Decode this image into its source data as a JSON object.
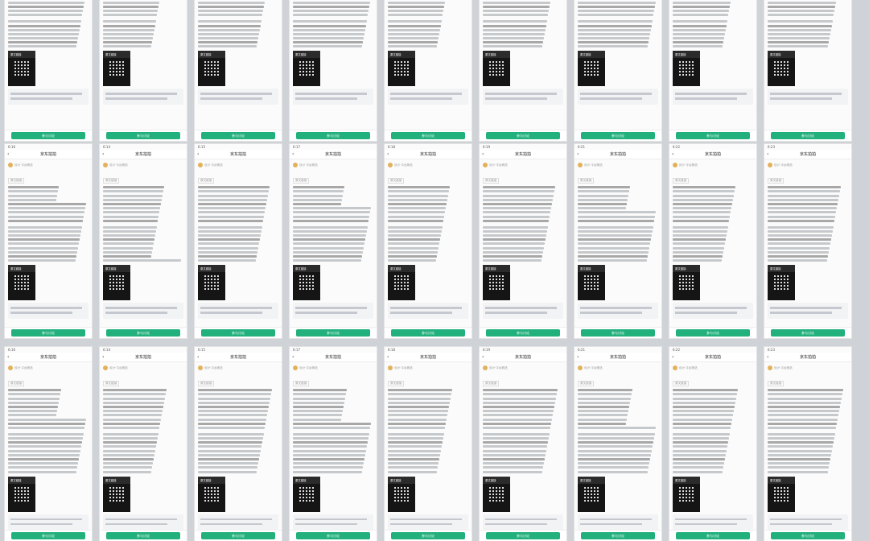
{
  "screen": {
    "title_bar_label": "京东拍拍",
    "status_times": [
      "6:16",
      "6:14",
      "6:15",
      "6:17",
      "6:18",
      "6:19",
      "6:21",
      "6:22",
      "6:23"
    ],
    "author_label": "设计·平台精选",
    "tag_label": "原文链接",
    "image_card_label": "原文链接",
    "cta_label": "参与讨论"
  },
  "cards": [
    {
      "lines": 14
    },
    {
      "lines": 14
    },
    {
      "lines": 14
    },
    {
      "lines": 14
    },
    {
      "lines": 14
    },
    {
      "lines": 14
    },
    {
      "lines": 14
    },
    {
      "lines": 14
    },
    {
      "lines": 14
    },
    {
      "lines": 18
    },
    {
      "lines": 18
    },
    {
      "lines": 18
    },
    {
      "lines": 18
    },
    {
      "lines": 18
    },
    {
      "lines": 18
    },
    {
      "lines": 18
    },
    {
      "lines": 18
    },
    {
      "lines": 18
    },
    {
      "lines": 20
    },
    {
      "lines": 20
    },
    {
      "lines": 20
    },
    {
      "lines": 20
    },
    {
      "lines": 20
    },
    {
      "lines": 20
    },
    {
      "lines": 20
    },
    {
      "lines": 20
    },
    {
      "lines": 20
    }
  ]
}
